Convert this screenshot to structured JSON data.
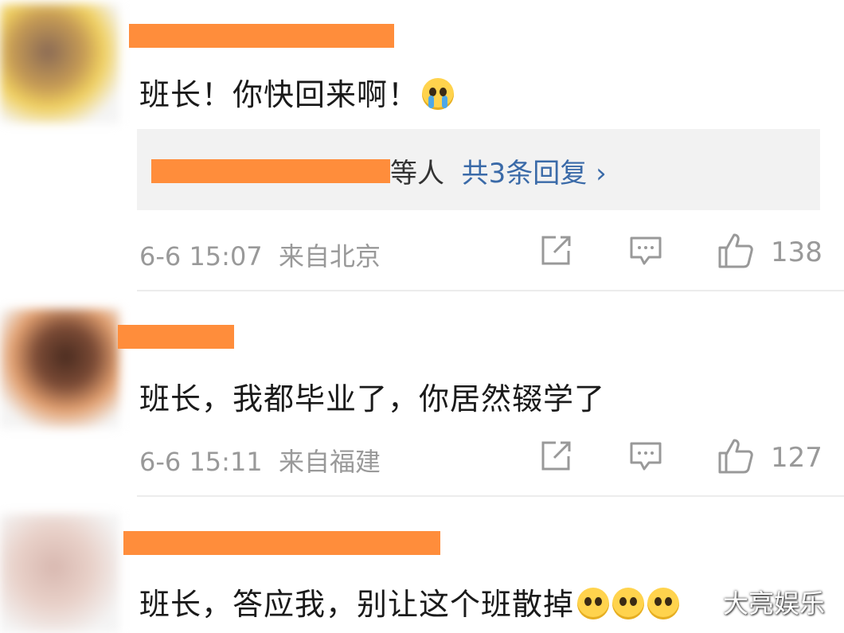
{
  "comments": [
    {
      "text": "班长！你快回来啊！",
      "emoji": "crying-face",
      "reply_summary": {
        "suffix": "等人",
        "link": "共3条回复 ›"
      },
      "date": "6-6 15:07",
      "location": "来自北京",
      "likes": "138"
    },
    {
      "text": "班长，我都毕业了，你居然辍学了",
      "date": "6-6 15:11",
      "location": "来自福建",
      "likes": "127"
    },
    {
      "text": "班长，答应我，别让这个班散掉",
      "emojis": [
        "pleading-face",
        "pleading-face",
        "pleading-face"
      ]
    }
  ],
  "watermark": "大亮娱乐",
  "colors": {
    "redaction": "#ff8d3b",
    "link": "#3a6aa8",
    "meta": "#999999"
  },
  "icons": [
    "share-icon",
    "comment-icon",
    "like-icon"
  ]
}
